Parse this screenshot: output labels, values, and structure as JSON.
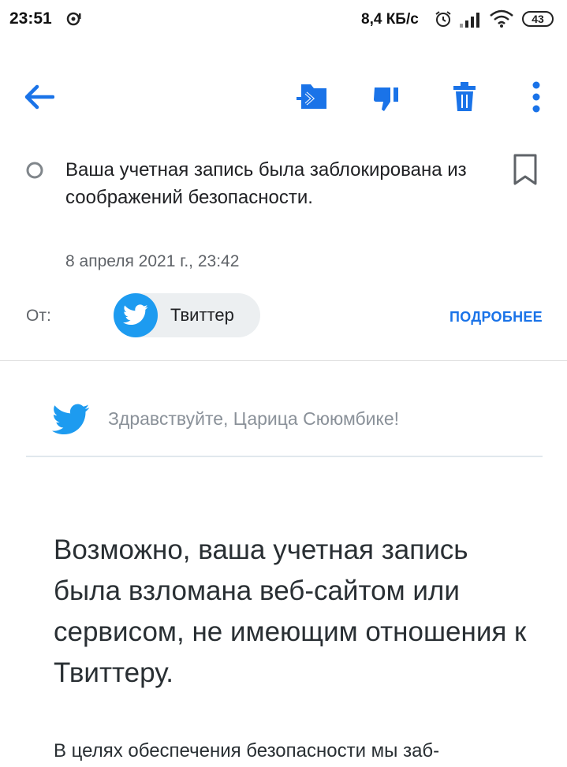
{
  "status_bar": {
    "time": "23:51",
    "network_speed": "8,4 КБ/с",
    "battery": "43"
  },
  "toolbar": {
    "back_icon": "back-arrow-icon",
    "move_icon": "move-to-folder-icon",
    "spam_icon": "thumb-down-icon",
    "delete_icon": "trash-icon",
    "more_icon": "more-vertical-icon",
    "accent_color": "#1a73e8"
  },
  "message": {
    "subject": "Ваша учетная запись была заблокирована из соображений безопасности.",
    "date": "8 апреля 2021 г., 23:42",
    "from_label": "От:",
    "sender_name": "Твиттер",
    "details_label": "ПОДРОБНЕЕ"
  },
  "email_body": {
    "greeting": "Здравствуйте, Царица Сююмбике!",
    "headline": "Возможно, ваша учетная запись была взломана веб-сайтом или сервисом, не имеющим отношения к Твиттеру.",
    "paragraph_start": "В целях обеспечения безопасности мы заб-"
  }
}
